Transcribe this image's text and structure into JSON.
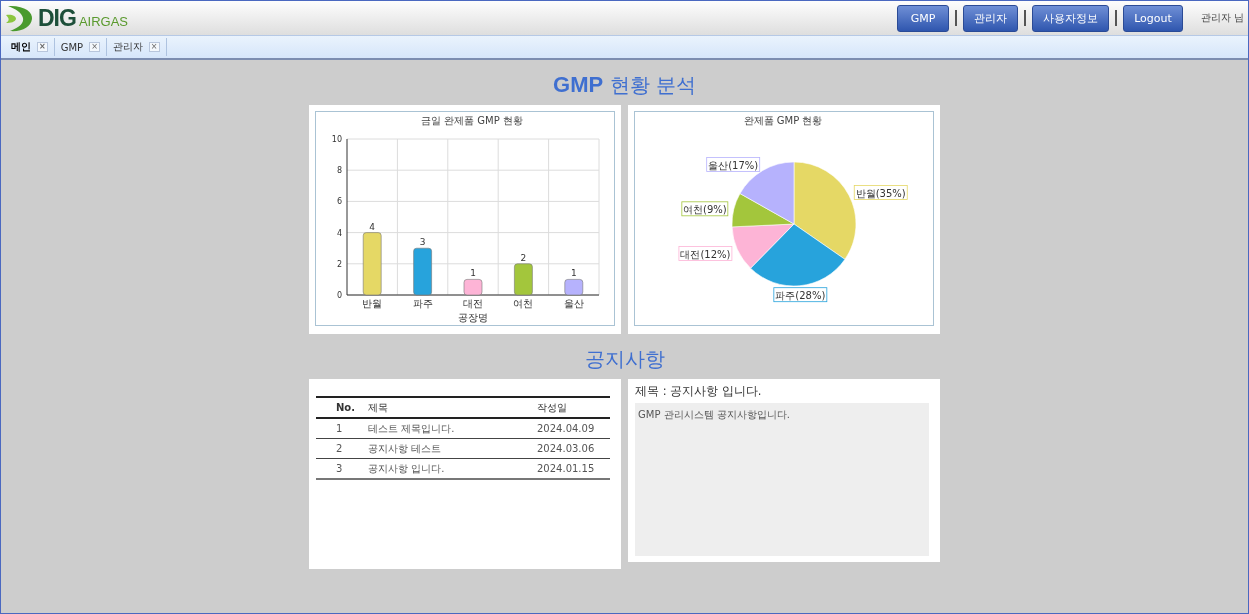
{
  "header": {
    "logo": {
      "brand": "DIG",
      "sub": "AIRGAS"
    },
    "buttons": [
      "GMP",
      "관리자",
      "사용자정보",
      "Logout"
    ],
    "user": "관리자 님"
  },
  "tabs": [
    {
      "label": "메인",
      "selected": true
    },
    {
      "label": "GMP",
      "selected": false
    },
    {
      "label": "관리자",
      "selected": false
    }
  ],
  "close_glyph": "×",
  "analysis": {
    "title": {
      "bold": "GMP",
      "rest": "현황 분석"
    },
    "bar_chart": {
      "chart_data": {
        "type": "bar",
        "title": "금일 완제품 GMP 현황",
        "xlabel": "공장명",
        "categories": [
          "반월",
          "파주",
          "대전",
          "여천",
          "울산"
        ],
        "values": [
          4,
          3,
          1,
          2,
          1
        ],
        "colors": [
          "#e5d865",
          "#27a3dc",
          "#fdb4d6",
          "#a3c63c",
          "#b6b2fd"
        ],
        "ylim": [
          0,
          10
        ],
        "yticks": [
          0,
          2,
          4,
          6,
          8,
          10
        ],
        "grid": true,
        "data_labels": true
      }
    },
    "pie_chart": {
      "chart_data": {
        "type": "pie",
        "title": "완제품 GMP 현황",
        "values": [
          35,
          28,
          12,
          9,
          17
        ],
        "colors": [
          "#e5d865",
          "#27a3dc",
          "#fdb4d6",
          "#a3c63c",
          "#b6b2fd"
        ],
        "value_labels": [
          "반월(35%)",
          "파주(28%)",
          "대전(12%)",
          "여천(9%)",
          "울산(17%)"
        ]
      }
    }
  },
  "notices": {
    "title": "공지사항",
    "table": {
      "columns": [
        "No.",
        "제목",
        "작성일"
      ],
      "rows": [
        [
          "1",
          "테스트 제목입니다.",
          "2024.04.09"
        ],
        [
          "2",
          "공지사항 테스트",
          "2024.03.06"
        ],
        [
          "3",
          "공지사항 입니다.",
          "2024.01.15"
        ]
      ]
    },
    "detail": {
      "title": "제목 : 공지사항 입니다.",
      "body": "GMP 관리시스템 공지사항입니다."
    }
  }
}
